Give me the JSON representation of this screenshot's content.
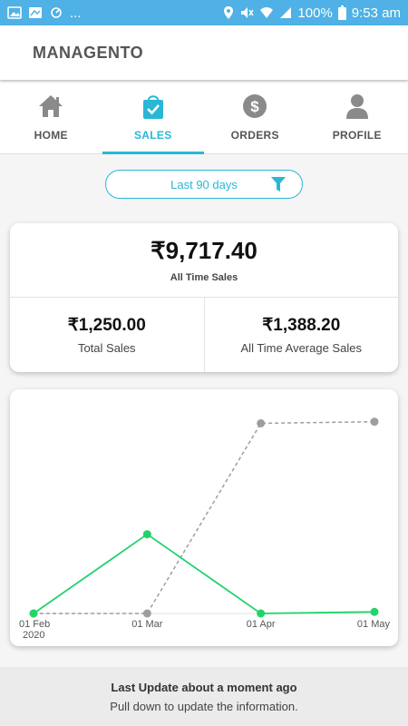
{
  "statusbar": {
    "dots": "...",
    "battery": "100%",
    "time": "9:53 am",
    "icons": [
      "image-icon",
      "gallery-icon",
      "sync-icon",
      "location-icon",
      "mute-icon",
      "wifi-icon",
      "signal-icon",
      "battery-icon"
    ]
  },
  "appbar": {
    "title": "MANAGENTO"
  },
  "tabs": [
    {
      "label": "HOME",
      "icon": "home-icon",
      "active": false
    },
    {
      "label": "SALES",
      "icon": "shopping-bag-icon",
      "active": true
    },
    {
      "label": "ORDERS",
      "icon": "dollar-icon",
      "active": false
    },
    {
      "label": "PROFILE",
      "icon": "person-icon",
      "active": false
    }
  ],
  "filter": {
    "label": "Last 90 days",
    "icon": "filter-icon"
  },
  "summary": {
    "all_time_value": "₹9,717.40",
    "all_time_label": "All Time Sales",
    "total_value": "₹1,250.00",
    "total_label": "Total Sales",
    "average_value": "₹1,388.20",
    "average_label": "All Time Average Sales"
  },
  "chart_data": {
    "type": "line",
    "x": [
      "01 Feb",
      "01 Mar",
      "01 Apr",
      "01 May"
    ],
    "x_sublabel": "2020",
    "ylim": [
      0,
      1300
    ],
    "grid": false,
    "series": [
      {
        "values": [
          0,
          500,
          0,
          10
        ],
        "color": "#22d36a",
        "style": "solid"
      },
      {
        "values": [
          0,
          0,
          1200,
          1210
        ],
        "color": "#9e9e9e",
        "style": "dashed"
      }
    ]
  },
  "footer": {
    "title": "Last Update about  a moment ago",
    "subtitle": "Pull down to update the information."
  },
  "colors": {
    "accent": "#2ab7d6",
    "statusbar": "#4fb1e5",
    "icon_grey": "#8a8a8a"
  }
}
